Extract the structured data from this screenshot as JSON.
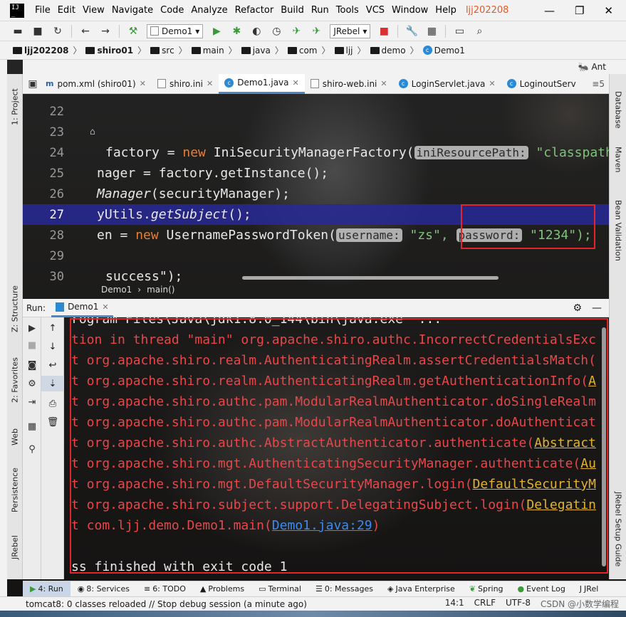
{
  "menubar": {
    "items": [
      "File",
      "Edit",
      "View",
      "Navigate",
      "Code",
      "Analyze",
      "Refactor",
      "Build",
      "Run",
      "Tools",
      "VCS",
      "Window",
      "Help"
    ],
    "project": "ljj202208"
  },
  "toolbar": {
    "run_config": "Demo1",
    "jrebel": "JRebel"
  },
  "breadcrumb": [
    "ljj202208",
    "shiro01",
    "src",
    "main",
    "java",
    "com",
    "ljj",
    "demo",
    "Demo1"
  ],
  "ant_label": "Ant",
  "tabs": [
    {
      "label": "pom.xml (shiro01)",
      "icon": "m"
    },
    {
      "label": "shiro.ini",
      "icon": "file"
    },
    {
      "label": "Demo1.java",
      "icon": "c",
      "active": true
    },
    {
      "label": "shiro-web.ini",
      "icon": "file"
    },
    {
      "label": "LoginServlet.java",
      "icon": "c"
    },
    {
      "label": "LoginoutServ",
      "icon": "c"
    }
  ],
  "tabs_more": "≡5",
  "editor": {
    "lines": [
      {
        "num": "22",
        "code": ""
      },
      {
        "num": "23",
        "code": ""
      },
      {
        "num": "24",
        "pre": "factory = ",
        "kw": "new",
        "mid": " IniSecurityManagerFactory(",
        "hint": "iniResourcePath:",
        "str": " \"classpath"
      },
      {
        "num": "25",
        "code": "nager = factory.getInstance();"
      },
      {
        "num": "26",
        "it": "Manager",
        "code": "(securityManager);"
      },
      {
        "num": "27",
        "pre": "yUtils.",
        "it": "getSubject",
        "code": "();"
      },
      {
        "num": "28",
        "pre": "en = ",
        "kw": "new",
        "mid": " UsernamePasswordToken(",
        "hint1": "username:",
        "str1": " \"zs\", ",
        "hint2": "password:",
        "str2": " \"1234\");"
      },
      {
        "num": "29",
        "code": ""
      },
      {
        "num": "30",
        "str": "success\");"
      }
    ],
    "crumb_class": "Demo1",
    "crumb_method": "main()"
  },
  "run_panel": {
    "label": "Run:",
    "tab": "Demo1"
  },
  "console": {
    "lines": [
      {
        "type": "plain",
        "text": "rogram Files\\Java\\jdk1.8.0_144\\bin\\java.exe\" ..."
      },
      {
        "type": "err",
        "text": "tion in thread \"main\" org.apache.shiro.authc.IncorrectCredentialsExc"
      },
      {
        "type": "err",
        "text": "t org.apache.shiro.realm.AuthenticatingRealm.assertCredentialsMatch("
      },
      {
        "type": "err",
        "text": "t org.apache.shiro.realm.AuthenticatingRealm.getAuthenticationInfo(",
        "link": "A"
      },
      {
        "type": "err",
        "text": "t org.apache.shiro.authc.pam.ModularRealmAuthenticator.doSingleRealm"
      },
      {
        "type": "err",
        "text": "t org.apache.shiro.authc.pam.ModularRealmAuthenticator.doAuthenticat"
      },
      {
        "type": "err",
        "text": "t org.apache.shiro.authc.AbstractAuthenticator.authenticate(",
        "link": "Abstract"
      },
      {
        "type": "err",
        "text": "t org.apache.shiro.mgt.AuthenticatingSecurityManager.authenticate(",
        "link": "Au"
      },
      {
        "type": "err",
        "text": "t org.apache.shiro.mgt.DefaultSecurityManager.login(",
        "link": "DefaultSecurityM"
      },
      {
        "type": "err",
        "text": "t org.apache.shiro.subject.support.DelegatingSubject.login(",
        "link": "Delegatin"
      },
      {
        "type": "err",
        "text": "t com.ljj.demo.Demo1.main(",
        "bluelink": "Demo1.java:29",
        "tail": ")"
      },
      {
        "type": "plain",
        "text": ""
      },
      {
        "type": "plain",
        "text": "ss finished with exit code 1"
      }
    ]
  },
  "left_tools": [
    "1: Project",
    "Z: Structure",
    "2: Favorites",
    "Web",
    "Persistence",
    "JRebel"
  ],
  "right_tools": [
    "Database",
    "Maven",
    "Bean Validation",
    "JRebel Setup Guide"
  ],
  "bottom_tabs": [
    "4: Run",
    "8: Services",
    "6: TODO",
    "Problems",
    "Terminal",
    "0: Messages",
    "Java Enterprise",
    "Spring",
    "Event Log",
    "JRel"
  ],
  "status": {
    "message": "tomcat8: 0 classes reloaded // Stop debug session (a minute ago)",
    "position": "14:1",
    "line_sep": "CRLF",
    "encoding": "UTF-8",
    "watermark": "CSDN @小数学编程"
  }
}
